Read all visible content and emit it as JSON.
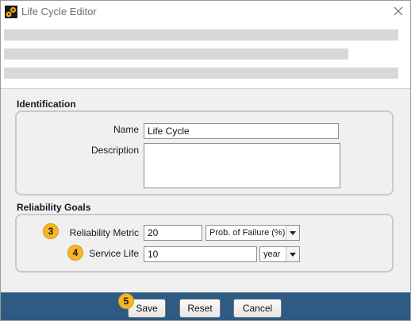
{
  "window": {
    "title": "Life Cycle Editor",
    "icons": {
      "app": "gears-icon",
      "close": "close-icon"
    }
  },
  "identification": {
    "title": "Identification",
    "name_label": "Name",
    "name_value": "Life Cycle",
    "description_label": "Description",
    "description_value": ""
  },
  "reliability_goals": {
    "title": "Reliability Goals",
    "metric_label": "Reliability Metric",
    "metric_value": "20",
    "metric_unit": "Prob. of Failure (%)",
    "service_life_label": "Service Life",
    "service_life_value": "10",
    "service_life_unit": "year"
  },
  "callouts": {
    "metric": "3",
    "service_life": "4",
    "save": "5"
  },
  "footer": {
    "save": "Save",
    "reset": "Reset",
    "cancel": "Cancel"
  },
  "colors": {
    "footer_bg": "#2d5b84",
    "badge": "#f6b526",
    "content_bg": "#f0f0f0"
  }
}
